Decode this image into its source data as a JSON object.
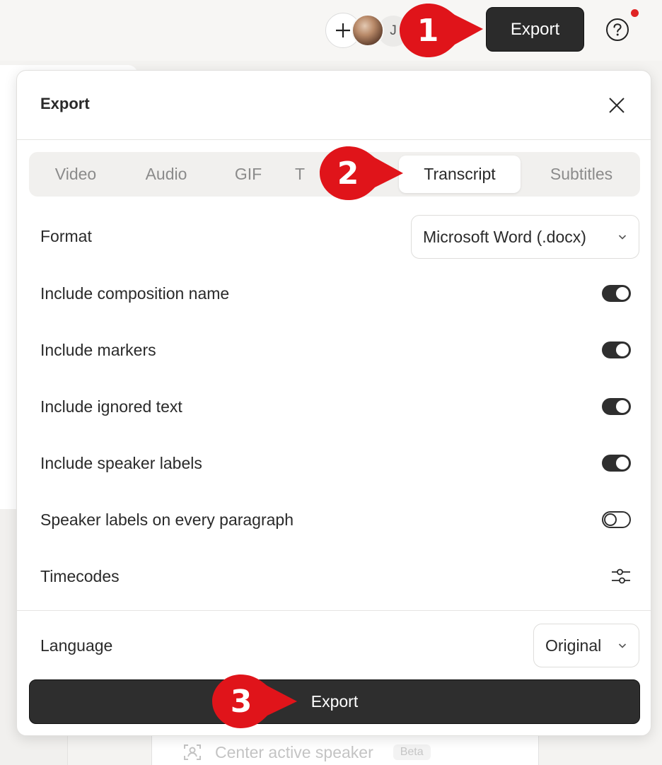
{
  "topbar": {
    "avatar_initial": "J",
    "export_label": "Export",
    "help_icon": "question-circle-icon"
  },
  "dialog": {
    "title": "Export",
    "tabs": [
      {
        "label": "Video"
      },
      {
        "label": "Audio"
      },
      {
        "label": "GIF"
      },
      {
        "label": "T"
      },
      {
        "label": "Transcript",
        "active": true
      },
      {
        "label": "Subtitles"
      }
    ],
    "format": {
      "label": "Format",
      "value": "Microsoft Word (.docx)"
    },
    "options": [
      {
        "label": "Include composition name",
        "on": true
      },
      {
        "label": "Include markers",
        "on": true
      },
      {
        "label": "Include ignored text",
        "on": true
      },
      {
        "label": "Include speaker labels",
        "on": true
      },
      {
        "label": "Speaker labels on every paragraph",
        "on": false
      }
    ],
    "timecodes": {
      "label": "Timecodes"
    },
    "language": {
      "label": "Language",
      "value": "Original"
    },
    "export_label": "Export"
  },
  "background": {
    "bottom_item_label": "Center active speaker",
    "bottom_item_badge": "Beta"
  },
  "callouts": [
    {
      "number": "1"
    },
    {
      "number": "2"
    },
    {
      "number": "3"
    }
  ],
  "colors": {
    "accent_dark": "#2e2e2e",
    "callout_red": "#e0141a",
    "notification": "#e02424"
  }
}
